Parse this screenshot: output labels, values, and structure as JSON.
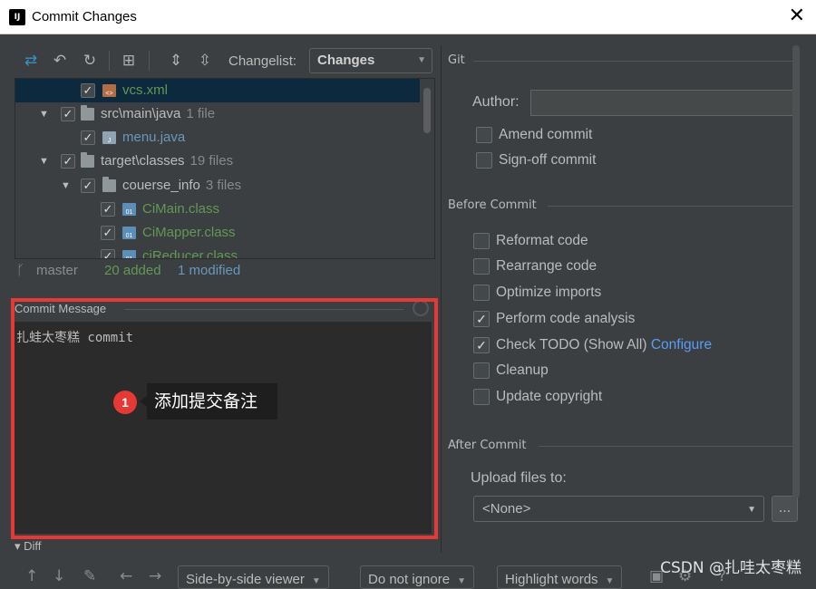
{
  "window": {
    "title": "Commit Changes",
    "app_icon_text": "IJ",
    "close_glyph": "✕"
  },
  "toolbar": {
    "icons": [
      "arrows-icon",
      "undo-icon",
      "refresh-icon",
      "group-icon",
      "expand-all-icon",
      "collapse-all-icon"
    ],
    "changelist_label": "Changelist:",
    "changelist_value": "Changes"
  },
  "tree": {
    "rows": [
      {
        "name": "vcs.xml",
        "count": "",
        "kind": "xml",
        "color": "green",
        "selected": true
      },
      {
        "name": "src\\main\\java",
        "count": "1 file",
        "kind": "folder",
        "color": "normal"
      },
      {
        "name": "menu.java",
        "count": "",
        "kind": "java",
        "color": "blue"
      },
      {
        "name": "target\\classes",
        "count": "19 files",
        "kind": "folder",
        "color": "normal"
      },
      {
        "name": "couerse_info",
        "count": "3 files",
        "kind": "folder",
        "color": "normal"
      },
      {
        "name": "CiMain.class",
        "count": "",
        "kind": "class",
        "color": "green"
      },
      {
        "name": "CiMapper.class",
        "count": "",
        "kind": "class",
        "color": "green"
      },
      {
        "name": "ciReducer.class",
        "count": "",
        "kind": "class",
        "color": "green"
      }
    ]
  },
  "status": {
    "branch": "master",
    "added": "20 added",
    "modified": "1 modified"
  },
  "commit_message": {
    "header": "Commit Message",
    "text": "扎蛙太枣糕 commit"
  },
  "annotation": {
    "number": "1",
    "text": "添加提交备注"
  },
  "diff": {
    "label": "Diff"
  },
  "bottom": {
    "viewer": "Side-by-side viewer",
    "ignore": "Do not ignore",
    "highlight": "Highlight words",
    "help": "?"
  },
  "git": {
    "section": "Git",
    "author_label": "Author:",
    "author_value": "",
    "amend": "Amend commit",
    "signoff": "Sign-off commit"
  },
  "before_commit": {
    "section": "Before Commit",
    "options": [
      {
        "label": "Reformat code",
        "checked": false
      },
      {
        "label": "Rearrange code",
        "checked": false
      },
      {
        "label": "Optimize imports",
        "checked": false
      },
      {
        "label": "Perform code analysis",
        "checked": true
      },
      {
        "label": "Check TODO (Show All)",
        "checked": true,
        "link": "Configure"
      },
      {
        "label": "Cleanup",
        "checked": false
      },
      {
        "label": "Update copyright",
        "checked": false
      }
    ]
  },
  "after_commit": {
    "section": "After Commit",
    "upload_label": "Upload files to:",
    "upload_value": "<None>",
    "more": "..."
  },
  "watermark": "CSDN @扎哇太枣糕"
}
